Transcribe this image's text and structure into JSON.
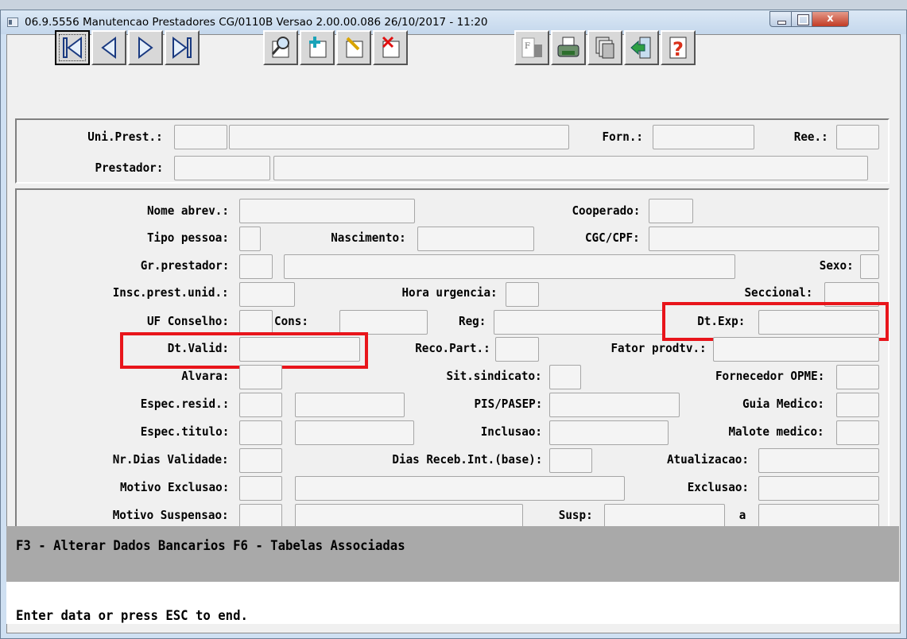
{
  "window": {
    "title": "06.9.5556 Manutencao  Prestadores CG/0110B Versao 2.00.00.086 26/10/2017 - 11:20",
    "close_glyph": "x"
  },
  "toolbar": {
    "buttons": [
      {
        "name": "first-record-button",
        "icon": "first-icon"
      },
      {
        "name": "previous-record-button",
        "icon": "previous-icon"
      },
      {
        "name": "next-record-button",
        "icon": "next-icon"
      },
      {
        "name": "last-record-button",
        "icon": "last-icon"
      },
      {
        "name": "search-button",
        "icon": "magnifier-icon"
      },
      {
        "name": "add-button",
        "icon": "add-icon"
      },
      {
        "name": "edit-button",
        "icon": "edit-icon"
      },
      {
        "name": "delete-button",
        "icon": "delete-icon"
      },
      {
        "name": "filter-button",
        "icon": "filter-icon"
      },
      {
        "name": "print-button",
        "icon": "printer-icon"
      },
      {
        "name": "copy-button",
        "icon": "copy-icon"
      },
      {
        "name": "exit-button",
        "icon": "exit-icon"
      },
      {
        "name": "help-button",
        "icon": "help-icon"
      }
    ]
  },
  "header": {
    "uni_prest": "Uni.Prest.:",
    "forn": "Forn.:",
    "ree": "Ree.:",
    "prestador": "Prestador:"
  },
  "form": {
    "nome_abrev": "Nome abrev.:",
    "cooperado": "Cooperado:",
    "tipo_pessoa": "Tipo pessoa:",
    "nascimento": "Nascimento:",
    "cgc_cpf": "CGC/CPF:",
    "gr_prestador": "Gr.prestador:",
    "sexo": "Sexo:",
    "insc_prest": "Insc.prest.unid.:",
    "hora_urgencia": "Hora urgencia:",
    "seccional": "Seccional:",
    "uf_conselho": "UF Conselho:",
    "cons": "Cons:",
    "reg": "Reg:",
    "dt_exp": "Dt.Exp:",
    "dt_valid": "Dt.Valid:",
    "reco_part": "Reco.Part.:",
    "fator_prodtv": "Fator prodtv.:",
    "alvara": "Alvara:",
    "sit_sindicato": "Sit.sindicato:",
    "fornecedor_opme": "Fornecedor OPME:",
    "espec_resid": "Espec.resid.:",
    "pis_pasep": "PIS/PASEP:",
    "guia_medico": "Guia Medico:",
    "espec_titulo": "Espec.titulo:",
    "inclusao": "Inclusao:",
    "malote_medico": "Malote medico:",
    "nr_dias_validade": "Nr.Dias Validade:",
    "dias_receb": "Dias Receb.Int.(base):",
    "atualizacao": "Atualizacao:",
    "motivo_exclusao": "Motivo Exclusao:",
    "exclusao": "Exclusao:",
    "motivo_suspensao": "Motivo Suspensao:",
    "susp": "Susp:",
    "a": "a"
  },
  "status": {
    "function_keys": "F3 - Alterar Dados Bancarios  F6 - Tabelas Associadas",
    "message": "Enter data or press ESC to end."
  },
  "colors": {
    "highlight": "#e8151b",
    "status_bar": "#a9a9a9"
  }
}
